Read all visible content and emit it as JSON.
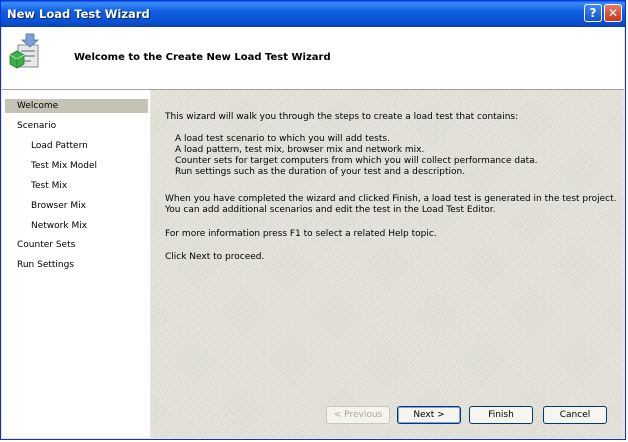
{
  "window": {
    "title": "New Load Test Wizard"
  },
  "titlebar": {
    "help_label": "?",
    "close_label": "✕"
  },
  "header": {
    "title": "Welcome to the Create New Load Test Wizard"
  },
  "nav": {
    "items": [
      {
        "label": "Welcome",
        "level": 0,
        "selected": true
      },
      {
        "label": "Scenario",
        "level": 0
      },
      {
        "label": "Load Pattern",
        "level": 1
      },
      {
        "label": "Test Mix Model",
        "level": 1
      },
      {
        "label": "Test Mix",
        "level": 1
      },
      {
        "label": "Browser Mix",
        "level": 1
      },
      {
        "label": "Network Mix",
        "level": 1
      },
      {
        "label": "Counter Sets",
        "level": 0
      },
      {
        "label": "Run Settings",
        "level": 0
      }
    ]
  },
  "content": {
    "intro": "This wizard will walk you through the steps to create a load test that contains:",
    "bullets": [
      "A load test scenario to which you will add tests.",
      "A load pattern, test mix, browser mix and network mix.",
      "Counter sets for target computers from which you will collect performance data.",
      "Run settings such as the duration of your test and a description."
    ],
    "finish_line1": "When you have completed the wizard and clicked Finish, a load test is generated in the test project.",
    "finish_line2": "You can add additional scenarios and edit the test in the Load Test Editor.",
    "help_text": "For more information press F1 to select a related Help topic.",
    "proceed_text": "Click Next to proceed."
  },
  "buttons": {
    "previous": "< Previous",
    "next": "Next >",
    "finish": "Finish",
    "cancel": "Cancel"
  }
}
